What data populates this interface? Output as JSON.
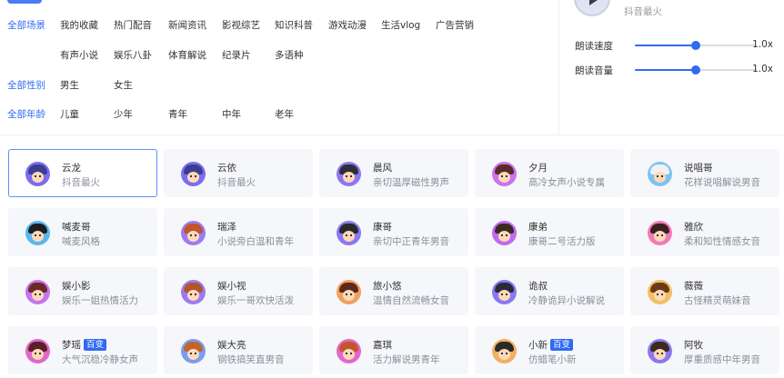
{
  "filters": {
    "scene": {
      "head": "全部场景",
      "row1": [
        "我的收藏",
        "热门配音",
        "新闻资讯",
        "影视综艺",
        "知识科普",
        "游戏动漫",
        "生活vlog",
        "广告营销"
      ],
      "row2": [
        "有声小说",
        "娱乐八卦",
        "体育解说",
        "纪录片",
        "多语种"
      ]
    },
    "gender": {
      "head": "全部性别",
      "items": [
        "男生",
        "女生"
      ]
    },
    "age": {
      "head": "全部年龄",
      "items": [
        "儿童",
        "少年",
        "青年",
        "中年",
        "老年"
      ]
    }
  },
  "panel": {
    "current_voice_desc": "抖音最火",
    "speed": {
      "label": "朗读速度",
      "value_text": "1.0x",
      "level": 0.5
    },
    "volume": {
      "label": "朗读音量",
      "value_text": "1.0x",
      "level": 0.5
    }
  },
  "voices": [
    {
      "name": "云龙",
      "desc": "抖音最火",
      "badge": "",
      "selected": true,
      "hair": "#3b3f8f",
      "bg": "#7b6cf0"
    },
    {
      "name": "云依",
      "desc": "抖音最火",
      "badge": "",
      "selected": false,
      "hair": "#3b3f8f",
      "bg": "#7b6cf0"
    },
    {
      "name": "晨风",
      "desc": "亲切温厚磁性男声",
      "badge": "",
      "selected": false,
      "hair": "#2d2f3a",
      "bg": "#8a78f2"
    },
    {
      "name": "夕月",
      "desc": "高冷女声小说专属",
      "badge": "",
      "selected": false,
      "hair": "#5a2a2a",
      "bg": "#c873f0"
    },
    {
      "name": "说唱哥",
      "desc": "花样说唱解说男音",
      "badge": "",
      "selected": false,
      "hair": "#f1f1f1",
      "bg": "#7dc3f2"
    },
    {
      "name": "喊麦哥",
      "desc": "喊麦风格",
      "badge": "",
      "selected": false,
      "hair": "#1e1e1e",
      "bg": "#5ab8f0"
    },
    {
      "name": "瑞泽",
      "desc": "小说旁白温和青年",
      "badge": "",
      "selected": false,
      "hair": "#c2552e",
      "bg": "#9a7cf2"
    },
    {
      "name": "康哥",
      "desc": "亲切中正青年男音",
      "badge": "",
      "selected": false,
      "hair": "#2a2a2a",
      "bg": "#8a78f2"
    },
    {
      "name": "康弟",
      "desc": "康哥二号活力版",
      "badge": "",
      "selected": false,
      "hair": "#3a2a22",
      "bg": "#c06cf0"
    },
    {
      "name": "雅欣",
      "desc": "柔和知性情感女音",
      "badge": "",
      "selected": false,
      "hair": "#3a2020",
      "bg": "#f07ab8"
    },
    {
      "name": "娱小影",
      "desc": "娱乐一姐热情活力",
      "badge": "",
      "selected": false,
      "hair": "#6a2a2a",
      "bg": "#c873f0"
    },
    {
      "name": "娱小视",
      "desc": "娱乐一哥欢快活泼",
      "badge": "",
      "selected": false,
      "hair": "#b0552e",
      "bg": "#9a7cf2"
    },
    {
      "name": "旅小悠",
      "desc": "温情自然流畅女音",
      "badge": "",
      "selected": false,
      "hair": "#5a2a1a",
      "bg": "#f0a060"
    },
    {
      "name": "诡叔",
      "desc": "冷静诡异小说解说",
      "badge": "",
      "selected": false,
      "hair": "#2a2a3a",
      "bg": "#8a78f2"
    },
    {
      "name": "薇薇",
      "desc": "古怪精灵萌妹音",
      "badge": "",
      "selected": false,
      "hair": "#6a3a1a",
      "bg": "#f0c060"
    },
    {
      "name": "梦瑶",
      "desc": "大气沉稳冷静女声",
      "badge": "百变",
      "selected": false,
      "hair": "#5a1f2a",
      "bg": "#e069c8"
    },
    {
      "name": "娱大亮",
      "desc": "钢铁搞笑直男音",
      "badge": "",
      "selected": false,
      "hair": "#c0652e",
      "bg": "#7a9cf2"
    },
    {
      "name": "嘉琪",
      "desc": "活力解说男青年",
      "badge": "",
      "selected": false,
      "hair": "#c2552e",
      "bg": "#e069c8"
    },
    {
      "name": "小新",
      "desc": "仿蜡笔小新",
      "badge": "百变",
      "selected": false,
      "hair": "#2a2a2a",
      "bg": "#f0b060"
    },
    {
      "name": "阿牧",
      "desc": "厚重质感中年男音",
      "badge": "",
      "selected": false,
      "hair": "#3a2a1a",
      "bg": "#8a78f2"
    }
  ]
}
